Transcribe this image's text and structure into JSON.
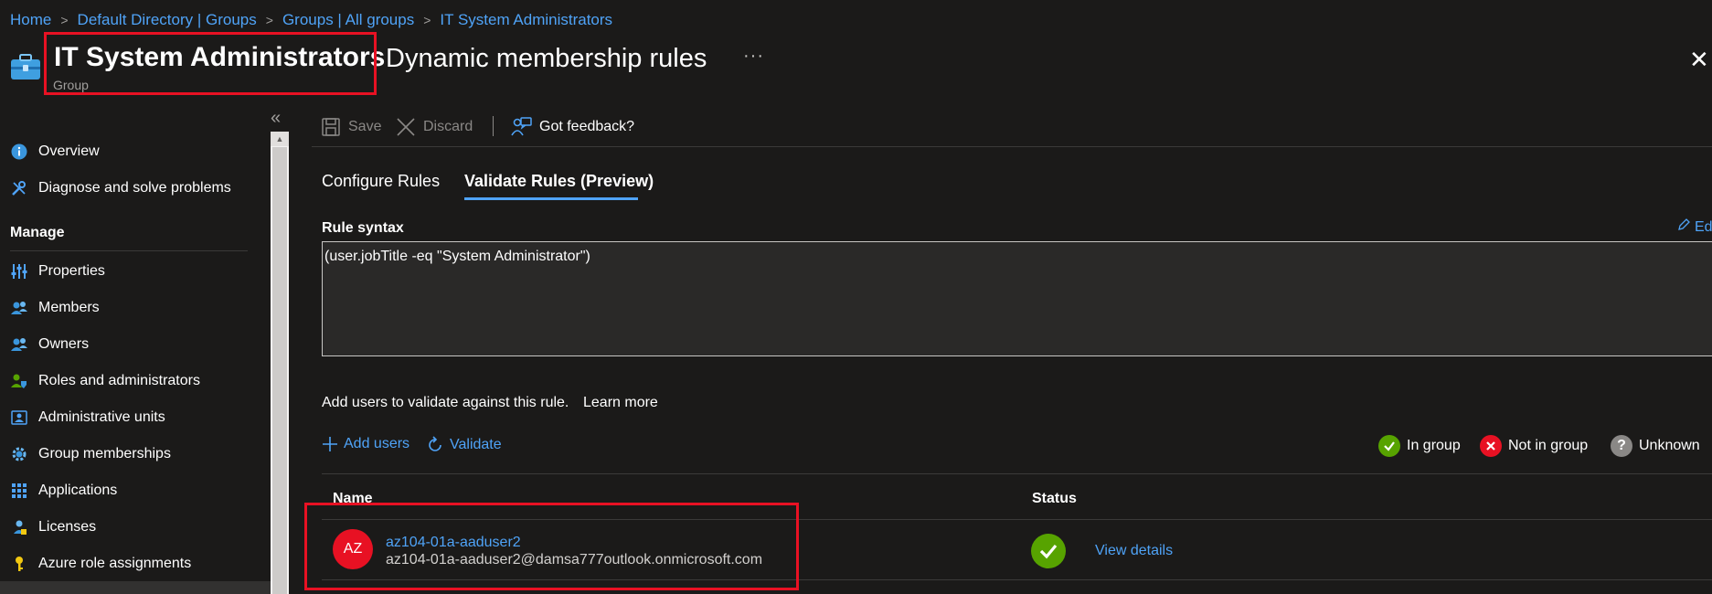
{
  "breadcrumb": [
    "Home",
    "Default Directory | Groups",
    "Groups | All groups",
    "IT System Administrators"
  ],
  "header": {
    "title": "IT System Administrators",
    "page": "Dynamic membership rules",
    "subtitle": "Group",
    "more": "···",
    "close": "✕"
  },
  "sidebar": {
    "collapse": "«",
    "items_top": [
      {
        "label": "Overview",
        "icon": "info-icon"
      },
      {
        "label": "Diagnose and solve problems",
        "icon": "wrench-icon"
      }
    ],
    "section": "Manage",
    "items_manage": [
      {
        "label": "Properties",
        "icon": "sliders-icon"
      },
      {
        "label": "Members",
        "icon": "people-icon"
      },
      {
        "label": "Owners",
        "icon": "people-icon"
      },
      {
        "label": "Roles and administrators",
        "icon": "person-shield-icon"
      },
      {
        "label": "Administrative units",
        "icon": "admin-units-icon"
      },
      {
        "label": "Group memberships",
        "icon": "gear-icon"
      },
      {
        "label": "Applications",
        "icon": "grid-icon"
      },
      {
        "label": "Licenses",
        "icon": "license-icon"
      },
      {
        "label": "Azure role assignments",
        "icon": "key-icon"
      }
    ]
  },
  "toolbar": {
    "save": "Save",
    "discard": "Discard",
    "feedback": "Got feedback?"
  },
  "tabs": [
    "Configure Rules",
    "Validate Rules (Preview)"
  ],
  "rule": {
    "label": "Rule syntax",
    "edit": "Edi",
    "syntax": "(user.jobTitle -eq \"System Administrator\")"
  },
  "validate": {
    "text": "Add users to validate against this rule.",
    "learn_more": "Learn more",
    "add_users": "Add users",
    "validate": "Validate"
  },
  "legend": {
    "in_group": "In group",
    "not_in_group": "Not in group",
    "unknown": "Unknown"
  },
  "table": {
    "headers": [
      "Name",
      "Status"
    ],
    "rows": [
      {
        "initials": "AZ",
        "name": "az104-01a-aaduser2",
        "email": "az104-01a-aaduser2@damsa777outlook.onmicrosoft.com",
        "status": "In group",
        "action": "View details"
      }
    ]
  },
  "colors": {
    "accent": "#4fa3f7",
    "highlight": "#e81123",
    "success": "#57a300",
    "background": "#1b1a19"
  }
}
